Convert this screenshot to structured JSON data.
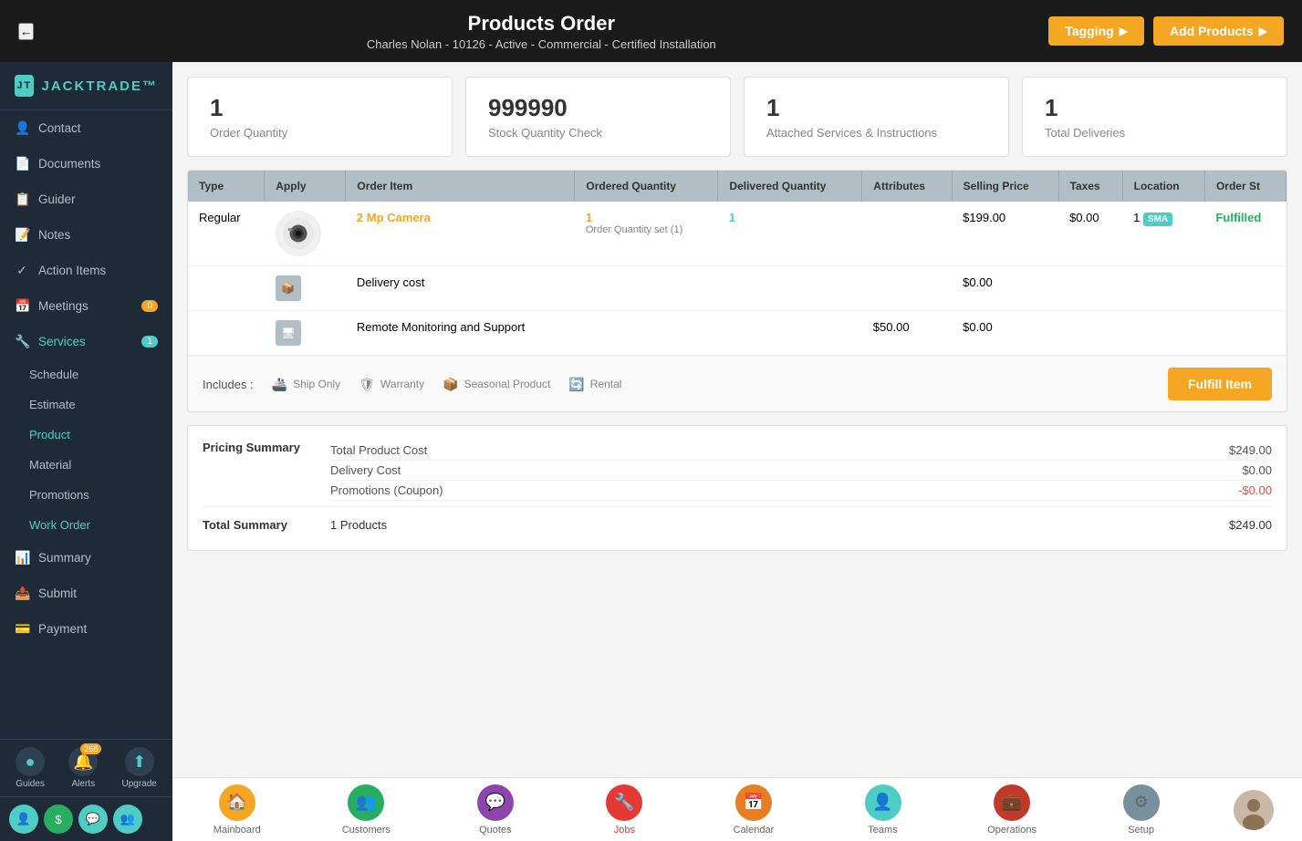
{
  "header": {
    "title": "Products Order",
    "subtitle": "Charles Nolan - 10126 - Active - Commercial - Certified Installation",
    "back_label": "←",
    "tagging_label": "Tagging",
    "add_products_label": "Add Products"
  },
  "sidebar": {
    "logo": "JACKTRADE™",
    "items": [
      {
        "id": "contact",
        "label": "Contact",
        "icon": "👤",
        "active": false
      },
      {
        "id": "documents",
        "label": "Documents",
        "icon": "📄",
        "active": false
      },
      {
        "id": "guider",
        "label": "Guider",
        "icon": "📋",
        "active": false
      },
      {
        "id": "notes",
        "label": "Notes",
        "icon": "📝",
        "active": false
      },
      {
        "id": "action-items",
        "label": "Action Items",
        "icon": "✓",
        "active": false
      },
      {
        "id": "meetings",
        "label": "Meetings",
        "icon": "📅",
        "badge": "0",
        "active": false
      },
      {
        "id": "services",
        "label": "Services",
        "icon": "🔧",
        "badge_teal": "1",
        "active": true
      },
      {
        "id": "summary",
        "label": "Summary",
        "icon": "📊",
        "active": false
      },
      {
        "id": "submit",
        "label": "Submit",
        "icon": "📤",
        "active": false
      },
      {
        "id": "payment",
        "label": "Payment",
        "icon": "💳",
        "active": false
      }
    ],
    "sub_items": [
      {
        "id": "schedule",
        "label": "Schedule",
        "active": false
      },
      {
        "id": "estimate",
        "label": "Estimate",
        "active": false
      },
      {
        "id": "product",
        "label": "Product",
        "active": true
      },
      {
        "id": "material",
        "label": "Material",
        "active": false
      },
      {
        "id": "promotions",
        "label": "Promotions",
        "active": false
      },
      {
        "id": "work-order",
        "label": "Work Order",
        "active": true
      }
    ],
    "bottom_icons": [
      {
        "id": "guides",
        "label": "Guides",
        "color": "#4ecdc4"
      },
      {
        "id": "alerts",
        "label": "Alerts",
        "color": "#f5a623",
        "badge": "268"
      },
      {
        "id": "upgrade",
        "label": "Upgrade",
        "color": "#4ecdc4"
      }
    ]
  },
  "stats": [
    {
      "number": "1",
      "label": "Order Quantity"
    },
    {
      "number": "999990",
      "label": "Stock Quantity Check"
    },
    {
      "number": "1",
      "label": "Attached Services & Instructions"
    },
    {
      "number": "1",
      "label": "Total Deliveries"
    }
  ],
  "table": {
    "columns": [
      "Type",
      "Apply",
      "Order Item",
      "Ordered Quantity",
      "Delivered Quantity",
      "Attributes",
      "Selling Price",
      "Taxes",
      "Location",
      "Order St"
    ],
    "rows": [
      {
        "type": "Regular",
        "apply": "camera",
        "order_item": "2 Mp Camera",
        "ordered_qty": "1",
        "ordered_qty_sub": "Order Quantity set (1)",
        "delivered_qty": "1",
        "attributes": "",
        "selling_price": "$199.00",
        "taxes": "$0.00",
        "location": "1",
        "location_badge": "SMA",
        "order_status": "Fulfilled"
      }
    ],
    "service_rows": [
      {
        "icon": "📦",
        "label": "Delivery cost",
        "attributes": "",
        "selling_price": "$0.00",
        "taxes": ""
      },
      {
        "icon": "🖥",
        "label": "Remote Monitoring and Support",
        "attributes": "$50.00",
        "selling_price": "$0.00",
        "taxes": ""
      }
    ]
  },
  "includes": {
    "label": "Includes :",
    "items": [
      {
        "icon": "🚢",
        "label": "Ship Only"
      },
      {
        "icon": "🛡",
        "label": "Warranty"
      },
      {
        "icon": "📦",
        "label": "Seasonal Product"
      },
      {
        "icon": "🔄",
        "label": "Rental"
      }
    ],
    "fulfill_label": "Fulfill Item"
  },
  "pricing": {
    "section_label": "Pricing Summary",
    "lines": [
      {
        "label": "Total Product Cost",
        "amount": "$249.00",
        "negative": false
      },
      {
        "label": "Delivery Cost",
        "amount": "$0.00",
        "negative": false
      },
      {
        "label": "Promotions (Coupon)",
        "amount": "-$0.00",
        "negative": true
      }
    ],
    "total": {
      "label": "Total Summary",
      "products": "1 Products",
      "amount": "$249.00"
    }
  },
  "app_bar": {
    "items": [
      {
        "id": "mainboard",
        "label": "Mainboard",
        "icon": "🏠",
        "color": "yellow",
        "active": false
      },
      {
        "id": "customers",
        "label": "Customers",
        "icon": "👥",
        "color": "green",
        "active": false
      },
      {
        "id": "quotes",
        "label": "Quotes",
        "icon": "💬",
        "color": "purple",
        "active": false
      },
      {
        "id": "jobs",
        "label": "Jobs",
        "icon": "🔧",
        "color": "red",
        "active": true
      },
      {
        "id": "calendar",
        "label": "Calendar",
        "icon": "📅",
        "color": "orange",
        "active": false
      },
      {
        "id": "teams",
        "label": "Teams",
        "icon": "👤",
        "color": "teal",
        "active": false
      },
      {
        "id": "operations",
        "label": "Operations",
        "icon": "💼",
        "color": "red-dark",
        "active": false
      },
      {
        "id": "setup",
        "label": "Setup",
        "icon": "⚙",
        "color": "gray",
        "active": false
      }
    ]
  }
}
